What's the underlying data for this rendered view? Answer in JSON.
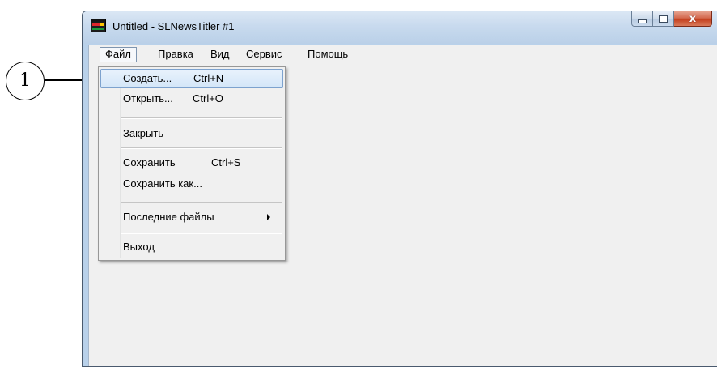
{
  "window": {
    "title": "Untitled - SLNewsTitler #1",
    "icon": "app-news-icon",
    "controls": {
      "minimize_icon": "minimize-icon",
      "maximize_icon": "maximize-icon",
      "close_glyph": "x"
    }
  },
  "menubar": {
    "items": [
      {
        "label": "Файл",
        "open": true
      },
      {
        "label": "Правка"
      },
      {
        "label": "Вид"
      },
      {
        "label": "Сервис"
      },
      {
        "label": "Помощь"
      }
    ]
  },
  "file_menu": {
    "items": [
      {
        "label": "Создать...",
        "shortcut": "Ctrl+N",
        "highlighted": true
      },
      {
        "label": "Открыть...",
        "shortcut": "Ctrl+O"
      },
      {
        "label": "Закрыть"
      },
      {
        "label": "Сохранить",
        "shortcut": "Ctrl+S"
      },
      {
        "label": "Сохранить как..."
      },
      {
        "label": "Последние файлы",
        "submenu": true
      },
      {
        "label": "Выход"
      }
    ]
  },
  "callout": {
    "number": "1"
  },
  "colors": {
    "highlight_border": "#7da2ce",
    "client_bg": "#f0f0f0",
    "frame": "#b9d1ea",
    "close_button": "#c4401f"
  }
}
